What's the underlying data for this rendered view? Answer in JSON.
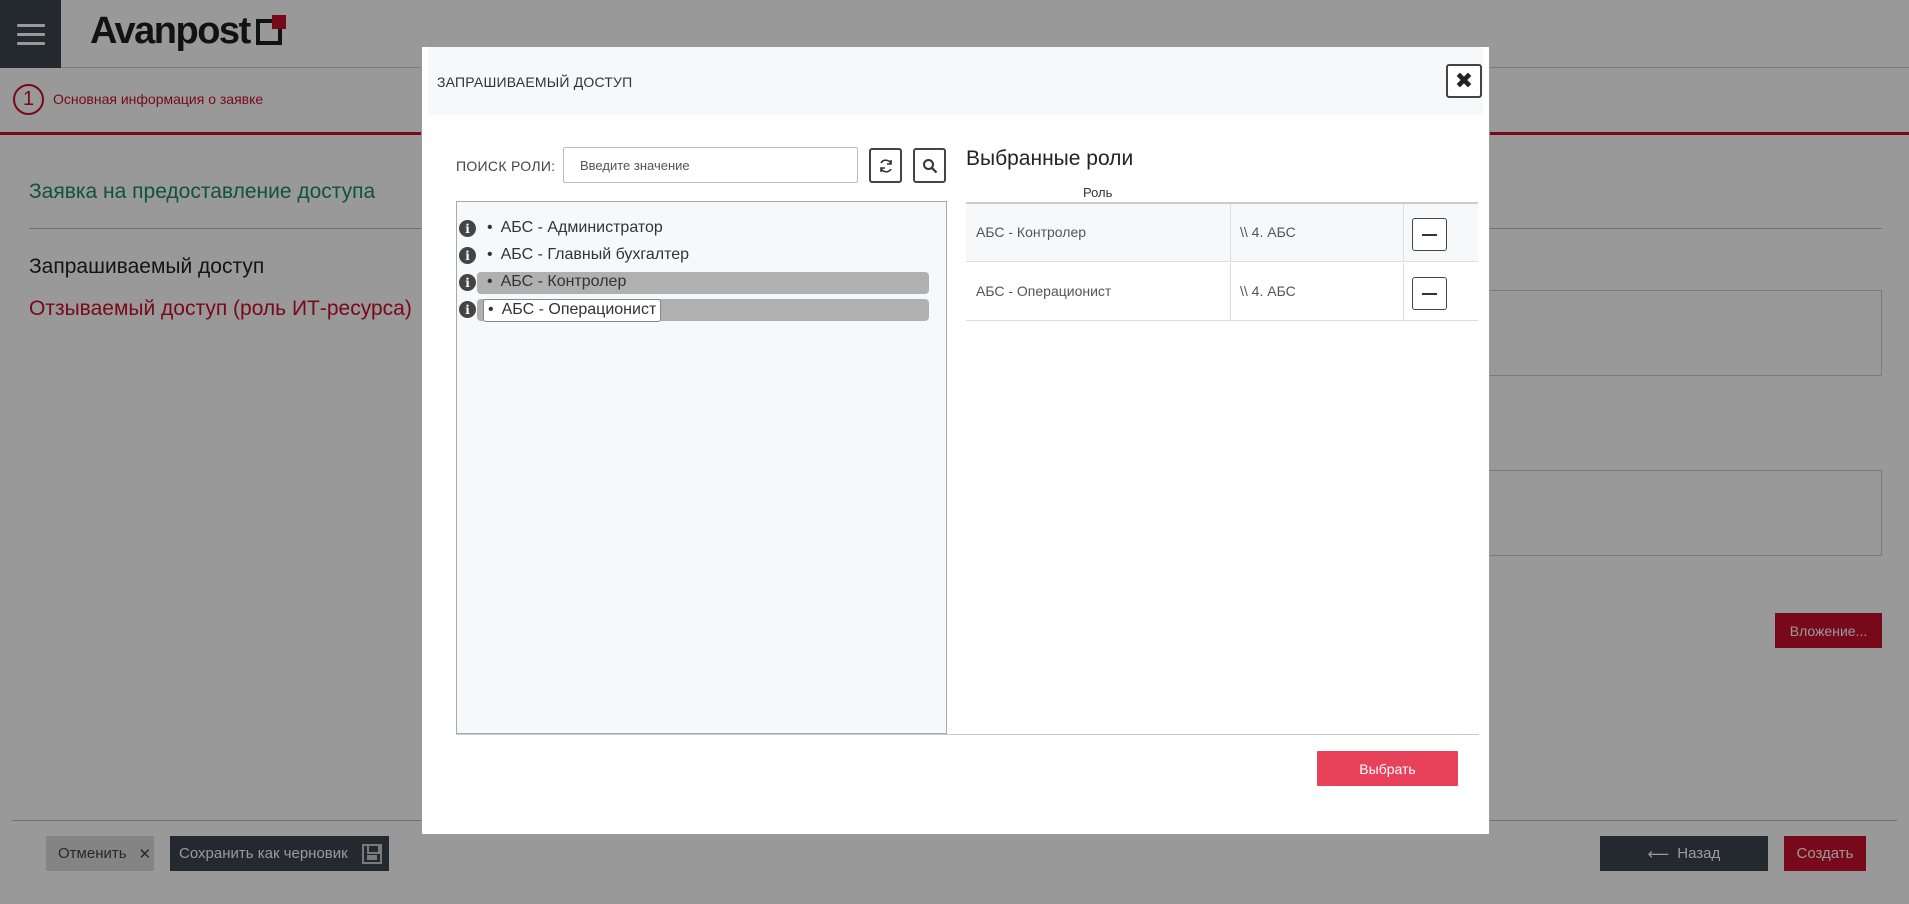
{
  "app": {
    "brand": "Avanpost",
    "step": {
      "number": "1",
      "label": "Основная информация о заявке"
    },
    "request_title": "Заявка на предоставление доступа",
    "section_requested": "Запрашиваемый доступ",
    "section_revoked": "Отзываемый доступ (роль ИТ-ресурса)",
    "attach_label": "Вложение...",
    "footer": {
      "cancel_label": "Отменить",
      "save_draft_label": "Сохранить как черновик",
      "back_label": "Назад",
      "create_label": "Создать"
    }
  },
  "modal": {
    "title": "ЗАПРАШИВАЕМЫЙ ДОСТУП",
    "search": {
      "label": "ПОИСК РОЛИ:",
      "placeholder": "Введите значение"
    },
    "roles": [
      {
        "label": "АБС - Администратор",
        "selected": false
      },
      {
        "label": "АБС - Главный бухгалтер",
        "selected": false
      },
      {
        "label": "АБС - Контролер",
        "selected": true
      },
      {
        "label": "АБС - Операционист",
        "selected": true,
        "focused": true
      }
    ],
    "selected_title": "Выбранные роли",
    "selected_column_header": "Роль",
    "selected_roles": [
      {
        "role": "АБС - Контролер",
        "path": "\\\\ 4. АБС"
      },
      {
        "role": "АБС - Операционист",
        "path": "\\\\ 4. АБС"
      }
    ],
    "select_button": "Выбрать"
  },
  "colors": {
    "accent": "#c8102e",
    "select_button": "#e8415a",
    "dark": "#3d4550",
    "title_green": "#1a8a6a"
  }
}
